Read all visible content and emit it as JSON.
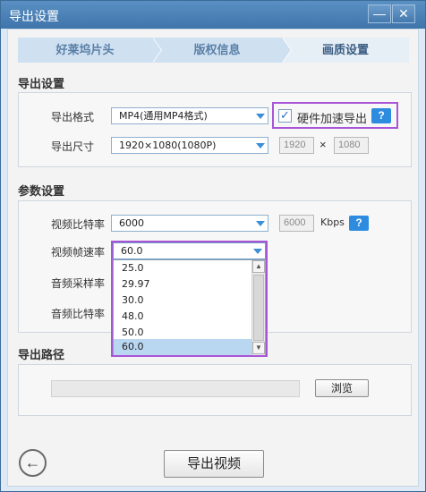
{
  "window": {
    "title": "导出设置",
    "minimize_icon": "minimize-icon",
    "close_icon": "close-icon"
  },
  "steps": [
    {
      "label": "好莱坞片头",
      "active": false
    },
    {
      "label": "版权信息",
      "active": false
    },
    {
      "label": "画质设置",
      "active": true
    }
  ],
  "export_settings": {
    "heading": "导出设置",
    "format_label": "导出格式",
    "format_value": "MP4(通用MP4格式)",
    "hw_accel_label": "硬件加速导出",
    "hw_accel_checked": true,
    "help": "?",
    "size_label": "导出尺寸",
    "size_value": "1920×1080(1080P)",
    "width": "1920",
    "times": "×",
    "height": "1080"
  },
  "params": {
    "heading": "参数设置",
    "video_bitrate_label": "视频比特率",
    "video_bitrate_value": "6000",
    "bitrate_box": "6000",
    "bitrate_unit": "Kbps",
    "help": "?",
    "framerate_label": "视频帧速率",
    "framerate_value": "60.0",
    "framerate_options": [
      "25.0",
      "29.97",
      "30.0",
      "48.0",
      "50.0",
      "60.0"
    ],
    "framerate_selected_index": 5,
    "audio_sample_label": "音频采样率",
    "audio_bitrate_label": "音频比特率"
  },
  "output_path": {
    "heading": "导出路径",
    "path_value": "",
    "browse_label": "浏览"
  },
  "footer": {
    "back_icon": "arrow-left-icon",
    "export_label": "导出视频"
  },
  "colors": {
    "accent": "#2d8be0",
    "highlight": "#a855d8",
    "titlebar": "#4a80b6"
  }
}
